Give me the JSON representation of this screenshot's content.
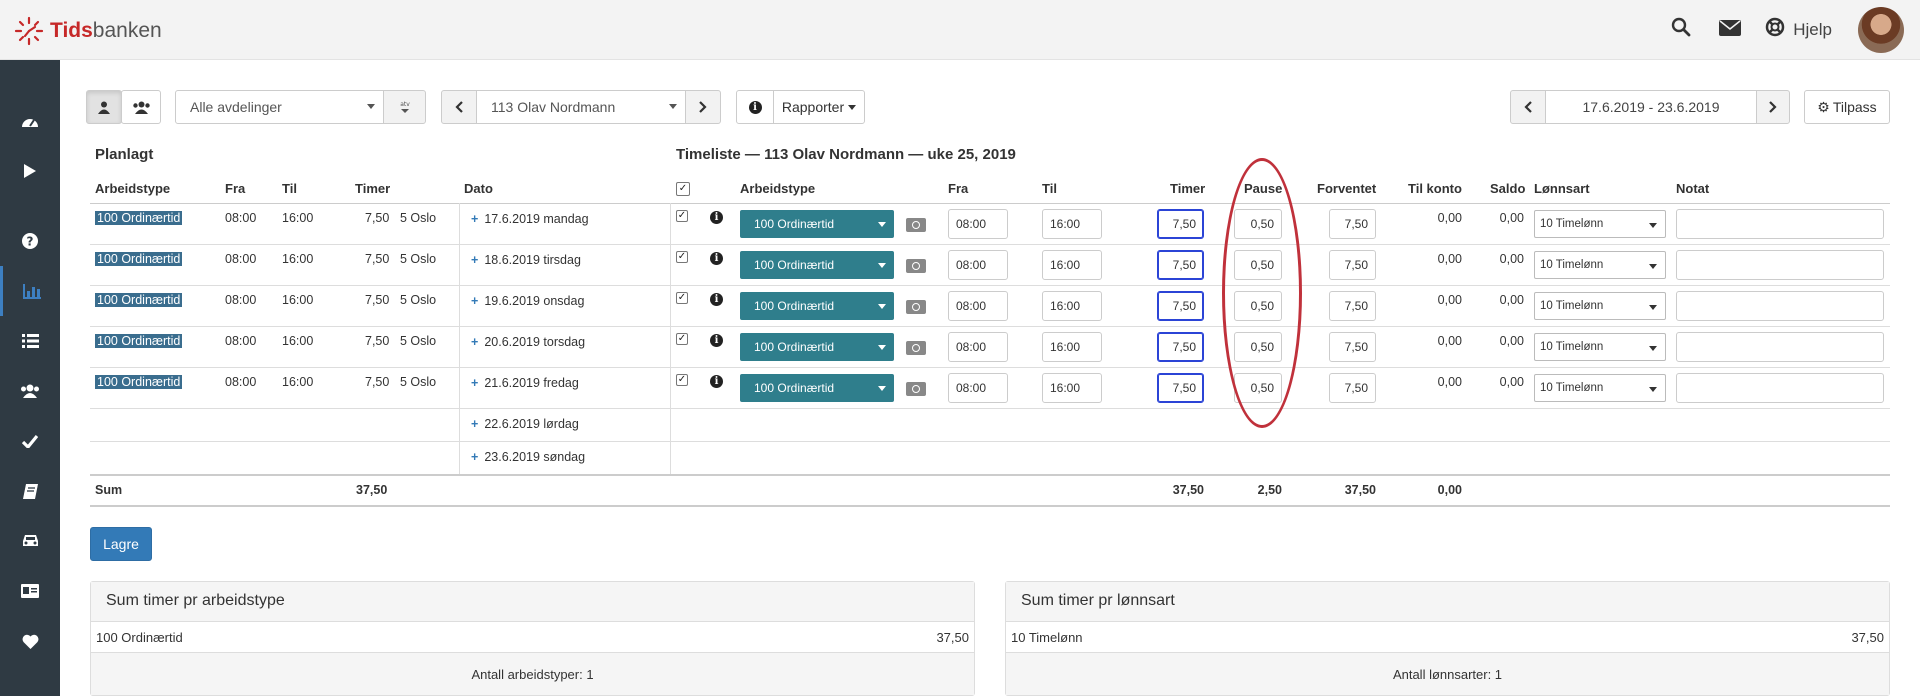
{
  "brand": {
    "part1": "Tids",
    "part2": "banken"
  },
  "topbar": {
    "help_label": "Hjelp",
    "icons": [
      "search-icon",
      "envelope-icon",
      "lifebuoy-icon"
    ]
  },
  "sidebar": {
    "icons": [
      "dashboard-icon",
      "play-icon",
      "question-icon",
      "bar-chart-icon",
      "list-icon",
      "users-icon",
      "check-icon",
      "book-icon",
      "car-icon",
      "id-card-icon",
      "heart-icon"
    ],
    "active": "bar-chart-icon"
  },
  "toolbar": {
    "department": "Alle avdelinger",
    "employee": "113 Olav Nordmann",
    "reports": "Rapporter",
    "date_range": "17.6.2019 - 23.6.2019",
    "customize": "Tilpass"
  },
  "planned": {
    "title": "Planlagt",
    "headers": [
      "Arbeidstype",
      "Fra",
      "Til",
      "Timer",
      "Dato"
    ],
    "rows": [
      {
        "type": "100 Ordinærtid",
        "from": "08:00",
        "to": "16:00",
        "hours": "7,50",
        "loc": "5 Oslo"
      },
      {
        "type": "100 Ordinærtid",
        "from": "08:00",
        "to": "16:00",
        "hours": "7,50",
        "loc": "5 Oslo"
      },
      {
        "type": "100 Ordinærtid",
        "from": "08:00",
        "to": "16:00",
        "hours": "7,50",
        "loc": "5 Oslo"
      },
      {
        "type": "100 Ordinærtid",
        "from": "08:00",
        "to": "16:00",
        "hours": "7,50",
        "loc": "5 Oslo"
      },
      {
        "type": "100 Ordinærtid",
        "from": "08:00",
        "to": "16:00",
        "hours": "7,50",
        "loc": "5 Oslo"
      }
    ],
    "dates": [
      "17.6.2019 mandag",
      "18.6.2019 tirsdag",
      "19.6.2019 onsdag",
      "20.6.2019 torsdag",
      "21.6.2019 fredag",
      "22.6.2019 lørdag",
      "23.6.2019 søndag"
    ],
    "sum_label": "Sum",
    "sum_hours": "37,50"
  },
  "timesheet": {
    "title": "Timeliste — 113 Olav Nordmann — uke 25, 2019",
    "headers": [
      "Arbeidstype",
      "Fra",
      "Til",
      "Timer",
      "Pause",
      "Forventet",
      "Til konto",
      "Saldo",
      "Lønnsart",
      "Notat"
    ],
    "rows": [
      {
        "type": "100 Ordinærtid",
        "from": "08:00",
        "to": "16:00",
        "hours": "7,50",
        "pause": "0,50",
        "expected": "7,50",
        "to_account": "0,00",
        "balance": "0,00",
        "wage": "10 Timelønn",
        "note": ""
      },
      {
        "type": "100 Ordinærtid",
        "from": "08:00",
        "to": "16:00",
        "hours": "7,50",
        "pause": "0,50",
        "expected": "7,50",
        "to_account": "0,00",
        "balance": "0,00",
        "wage": "10 Timelønn",
        "note": ""
      },
      {
        "type": "100 Ordinærtid",
        "from": "08:00",
        "to": "16:00",
        "hours": "7,50",
        "pause": "0,50",
        "expected": "7,50",
        "to_account": "0,00",
        "balance": "0,00",
        "wage": "10 Timelønn",
        "note": ""
      },
      {
        "type": "100 Ordinærtid",
        "from": "08:00",
        "to": "16:00",
        "hours": "7,50",
        "pause": "0,50",
        "expected": "7,50",
        "to_account": "0,00",
        "balance": "0,00",
        "wage": "10 Timelønn",
        "note": ""
      },
      {
        "type": "100 Ordinærtid",
        "from": "08:00",
        "to": "16:00",
        "hours": "7,50",
        "pause": "0,50",
        "expected": "7,50",
        "to_account": "0,00",
        "balance": "0,00",
        "wage": "10 Timelønn",
        "note": ""
      }
    ],
    "sum": {
      "hours": "37,50",
      "pause": "2,50",
      "expected": "37,50",
      "to_account": "0,00"
    }
  },
  "save_label": "Lagre",
  "panel_type": {
    "title": "Sum timer pr arbeidstype",
    "row_label": "100 Ordinærtid",
    "row_value": "37,50",
    "footer": "Antall arbeidstyper: 1"
  },
  "panel_wage": {
    "title": "Sum timer pr lønnsart",
    "row_label": "10 Timelønn",
    "row_value": "37,50",
    "footer": "Antall lønnsarter: 1"
  },
  "colors": {
    "accent": "#337ab7",
    "worktype": "#2f7e8c",
    "highlight": "#c0313b",
    "sidebar": "#2f3a43"
  }
}
